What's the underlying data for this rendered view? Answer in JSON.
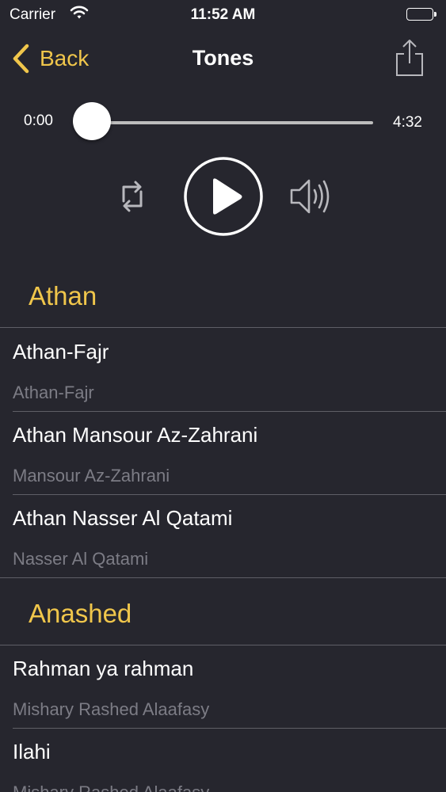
{
  "status_bar": {
    "carrier": "Carrier",
    "time": "11:52 AM"
  },
  "nav": {
    "back_label": "Back",
    "title": "Tones"
  },
  "player": {
    "current_time": "0:00",
    "duration": "4:32",
    "progress": 0.0
  },
  "sections": [
    {
      "title": "Athan",
      "items": [
        {
          "title": "Athan-Fajr",
          "subtitle": "Athan-Fajr"
        },
        {
          "title": "Athan Mansour Az-Zahrani",
          "subtitle": "Mansour Az-Zahrani"
        },
        {
          "title": "Athan Nasser Al Qatami",
          "subtitle": "Nasser Al Qatami"
        }
      ]
    },
    {
      "title": "Anashed",
      "items": [
        {
          "title": "Rahman ya rahman",
          "subtitle": "Mishary Rashed Alaafasy"
        },
        {
          "title": "Ilahi",
          "subtitle": "Mishary Rashed Alaafasy"
        }
      ]
    }
  ],
  "colors": {
    "background": "#26262e",
    "accent": "#f0c64b",
    "subtitle": "#7c7c85",
    "separator": "#5f5f66"
  },
  "icons": [
    "back-chevron-icon",
    "share-icon",
    "repeat-icon",
    "play-icon",
    "volume-icon",
    "wifi-icon",
    "battery-icon"
  ]
}
